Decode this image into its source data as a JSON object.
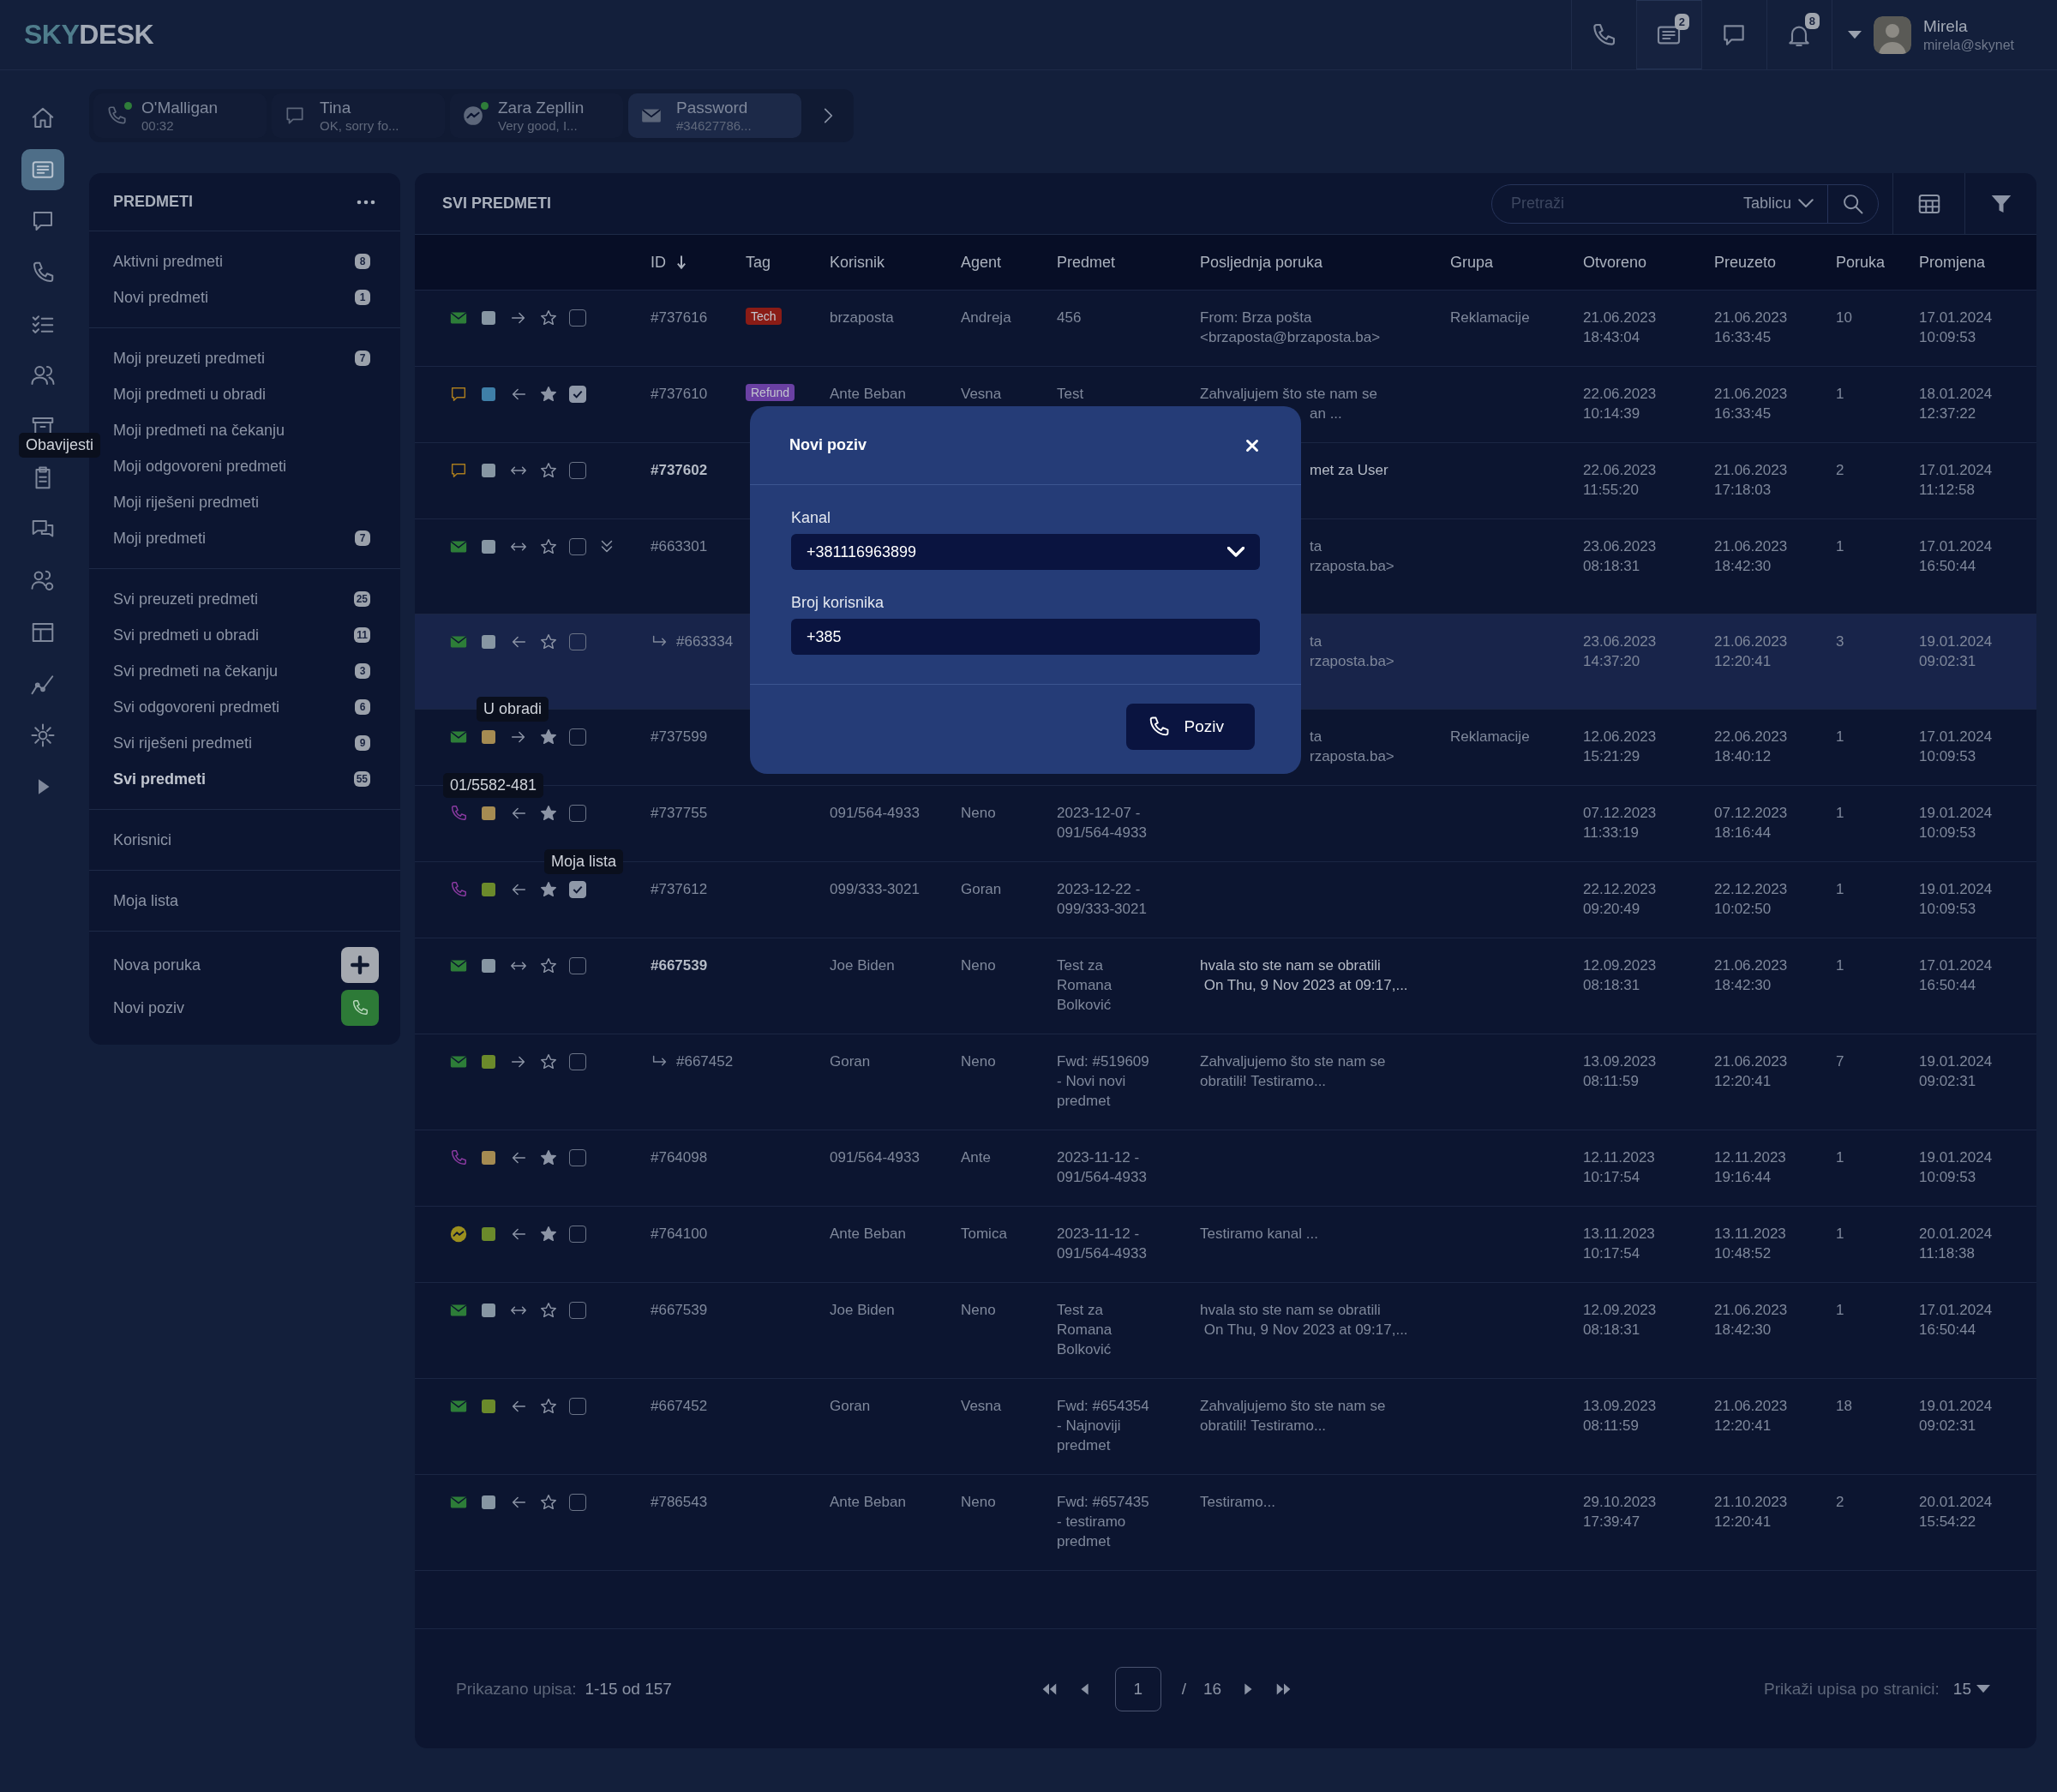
{
  "logo": {
    "first": "SKY",
    "second": "DESK"
  },
  "top_icons": [
    {
      "kind": "phone",
      "selected": false
    },
    {
      "kind": "tickets",
      "badge": "2",
      "selected": true
    },
    {
      "kind": "chat",
      "selected": false
    },
    {
      "kind": "bell",
      "badge": "8",
      "selected": false
    }
  ],
  "user": {
    "name": "Mirela",
    "email": "mirela@skynet"
  },
  "rail": [
    {
      "kind": "home",
      "selected": false
    },
    {
      "kind": "tickets",
      "selected": true
    },
    {
      "kind": "chat",
      "selected": false
    },
    {
      "kind": "phone",
      "selected": false
    },
    {
      "kind": "checklist",
      "selected": false
    },
    {
      "kind": "users",
      "selected": false
    },
    {
      "kind": "archive",
      "selected": false
    },
    {
      "kind": "clipboard",
      "selected": false
    },
    {
      "kind": "chats",
      "selected": false
    },
    {
      "kind": "usersgear",
      "selected": false
    },
    {
      "kind": "layout",
      "selected": false
    },
    {
      "kind": "chart",
      "selected": false
    },
    {
      "kind": "gear",
      "selected": false
    },
    {
      "kind": "play",
      "selected": false
    }
  ],
  "conversation_tabs": [
    {
      "kind": "phone",
      "name": "O'Malligan",
      "preview": "00:32",
      "online": true,
      "selected": false
    },
    {
      "kind": "chat",
      "name": "Tina",
      "preview": "OK, sorry fo...",
      "online": false,
      "selected": false
    },
    {
      "kind": "messenger",
      "name": "Zara Zepllin",
      "preview": "Very good, I...",
      "online": true,
      "selected": false
    },
    {
      "kind": "email",
      "name": "Password",
      "preview": "#34627786...",
      "online": false,
      "selected": true
    }
  ],
  "sidebar": {
    "title": "PREDMETI",
    "groups": [
      [
        {
          "kind": "link",
          "label": "Aktivni predmeti",
          "count": "8",
          "selected": false
        },
        {
          "kind": "link",
          "label": "Novi predmeti",
          "count": "1",
          "selected": false
        }
      ],
      [
        {
          "kind": "link",
          "label": "Moji preuzeti predmeti",
          "count": "7",
          "selected": false
        },
        {
          "kind": "link",
          "label": "Moji predmeti u obradi",
          "selected": false
        },
        {
          "kind": "link",
          "label": "Moji predmeti na čekanju",
          "selected": false
        },
        {
          "kind": "link",
          "label": "Moji odgovoreni predmeti",
          "selected": false
        },
        {
          "kind": "link",
          "label": "Moji riješeni predmeti",
          "selected": false
        },
        {
          "kind": "link",
          "label": "Moji predmeti",
          "count": "7",
          "selected": false
        }
      ],
      [
        {
          "kind": "link",
          "label": "Svi preuzeti predmeti",
          "count": "25",
          "selected": false
        },
        {
          "kind": "link",
          "label": "Svi predmeti u obradi",
          "count": "11",
          "selected": false
        },
        {
          "kind": "link",
          "label": "Svi predmeti na čekanju",
          "count": "3",
          "selected": false
        },
        {
          "kind": "link",
          "label": "Svi odgovoreni predmeti",
          "count": "6",
          "selected": false
        },
        {
          "kind": "link",
          "label": "Svi riješeni predmeti",
          "count": "9",
          "selected": false
        },
        {
          "kind": "link",
          "label": "Svi predmeti",
          "count": "55",
          "selected": true
        }
      ],
      [
        {
          "kind": "link",
          "label": "Korisnici",
          "selected": false
        }
      ],
      [
        {
          "kind": "link",
          "label": "Moja lista",
          "selected": false
        }
      ],
      [
        {
          "kind": "plus",
          "label": "Nova poruka",
          "selected": false
        },
        {
          "kind": "call",
          "label": "Novi poziv",
          "selected": false
        }
      ]
    ]
  },
  "panel": {
    "title": "SVI PREDMETI",
    "search": {
      "placeholder": "Pretraži",
      "scope": "Tablicu"
    }
  },
  "columns": [
    {
      "label": "ID",
      "sorted": true
    },
    {
      "label": "Tag",
      "sorted": false
    },
    {
      "label": "Korisnik",
      "sorted": false
    },
    {
      "label": "Agent",
      "sorted": false
    },
    {
      "label": "Predmet",
      "sorted": false
    },
    {
      "label": "Posljednja poruka",
      "sorted": false
    },
    {
      "label": "Grupa",
      "sorted": false
    },
    {
      "label": "Otvoreno",
      "sorted": false
    },
    {
      "label": "Preuzeto",
      "sorted": false
    },
    {
      "label": "Poruka",
      "sorted": false
    },
    {
      "label": "Promjena",
      "sorted": false
    }
  ],
  "rows": [
    {
      "kind": "email",
      "color": "#8796a3",
      "incoming": false,
      "outgoing": true,
      "starred": false,
      "checked": false,
      "expand": false,
      "forwarded": false,
      "unread": false,
      "hovered": false,
      "id": "#737616",
      "tag": {
        "label": "Tech",
        "color": "#8a1c16"
      },
      "user": "brzaposta",
      "agent": "Andreja",
      "subject": "456",
      "message": "From: Brza pošta\n<brzaposta@brzaposta.ba>",
      "group": "Reklamacije",
      "opened": "21.06.2023\n18:43:04",
      "taken": "21.06.2023\n16:33:45",
      "count": "10",
      "changed": "17.01.2024\n10:09:53"
    },
    {
      "kind": "chat",
      "color": "#3f7fa8",
      "incoming": true,
      "outgoing": false,
      "starred": true,
      "checked": true,
      "expand": false,
      "forwarded": false,
      "unread": false,
      "hovered": false,
      "id": "#737610",
      "tag": {
        "label": "Refund",
        "color": "#6a40a3"
      },
      "user": "Ante Beban",
      "agent": "Vesna",
      "subject": "Test",
      "message": "Zahvaljujem što ste nam se",
      "message_cut": "an ...",
      "opened": "22.06.2023\n10:14:39",
      "taken": "21.06.2023\n16:33:45",
      "count": "1",
      "changed": "18.01.2024\n12:37:22"
    },
    {
      "kind": "chat",
      "color": "#8796a3",
      "incoming": true,
      "outgoing": true,
      "starred": false,
      "checked": false,
      "expand": false,
      "forwarded": false,
      "unread": true,
      "hovered": false,
      "id": "#737602",
      "message_cut": "met za User",
      "opened": "22.06.2023\n11:55:20",
      "taken": "21.06.2023\n17:18:03",
      "count": "2",
      "changed": "17.01.2024\n11:12:58"
    },
    {
      "kind": "email",
      "color": "#8796a3",
      "incoming": true,
      "outgoing": true,
      "starred": false,
      "checked": false,
      "expand": true,
      "forwarded": false,
      "unread": false,
      "hovered": false,
      "id": "#663301",
      "message_cut": "ta\nrzaposta.ba>",
      "opened": "23.06.2023\n08:18:31",
      "taken": "21.06.2023\n18:42:30",
      "count": "1",
      "changed": "17.01.2024\n16:50:44"
    },
    {
      "kind": "email",
      "color": "#8796a3",
      "incoming": true,
      "outgoing": false,
      "starred": false,
      "checked": false,
      "expand": false,
      "forwarded": true,
      "unread": false,
      "hovered": true,
      "id": "#663334",
      "message_cut": "ta\nrzaposta.ba>",
      "opened": "23.06.2023\n14:37:20",
      "taken": "21.06.2023\n12:20:41",
      "count": "3",
      "changed": "19.01.2024\n09:02:31"
    },
    {
      "kind": "email",
      "color": "#a58b52",
      "incoming": false,
      "outgoing": true,
      "starred": true,
      "checked": false,
      "expand": false,
      "forwarded": false,
      "unread": false,
      "hovered": false,
      "id": "#737599",
      "group": "Reklamacije",
      "message_cut": "ta\nrzaposta.ba>",
      "opened": "12.06.2023\n15:21:29",
      "taken": "22.06.2023\n18:40:12",
      "count": "1",
      "changed": "17.01.2024\n10:09:53"
    },
    {
      "kind": "phone",
      "color": "#a58b52",
      "incoming": true,
      "outgoing": false,
      "starred": true,
      "checked": false,
      "expand": false,
      "forwarded": false,
      "unread": false,
      "hovered": false,
      "id": "#737755",
      "user": "091/564-4933",
      "agent": "Neno",
      "subject": "2023-12-07 -\n091/564-4933",
      "opened": "07.12.2023\n11:33:19",
      "taken": "07.12.2023\n18:16:44",
      "count": "1",
      "changed": "19.01.2024\n10:09:53"
    },
    {
      "kind": "phone",
      "color": "#6b8a2b",
      "incoming": true,
      "outgoing": false,
      "starred": true,
      "checked": true,
      "expand": false,
      "forwarded": false,
      "unread": false,
      "hovered": false,
      "id": "#737612",
      "user": "099/333-3021",
      "agent": "Goran",
      "subject": "2023-12-22 -\n099/333-3021",
      "opened": "22.12.2023\n09:20:49",
      "taken": "22.12.2023\n10:02:50",
      "count": "1",
      "changed": "19.01.2024\n10:09:53"
    },
    {
      "kind": "email",
      "color": "#8796a3",
      "incoming": true,
      "outgoing": true,
      "starred": false,
      "checked": false,
      "expand": false,
      "forwarded": false,
      "unread": true,
      "hovered": false,
      "id": "#667539",
      "user": "Joe Biden",
      "agent": "Neno",
      "subject": "Test za\nRomana\nBolković",
      "message": "hvala sto ste nam se obratili\n On Thu, 9 Nov 2023 at 09:17,...",
      "opened": "12.09.2023\n08:18:31",
      "taken": "21.06.2023\n18:42:30",
      "count": "1",
      "changed": "17.01.2024\n16:50:44"
    },
    {
      "kind": "email",
      "color": "#6b8a2b",
      "incoming": false,
      "outgoing": true,
      "starred": false,
      "checked": false,
      "expand": false,
      "forwarded": true,
      "unread": false,
      "hovered": false,
      "id": "#667452",
      "user": "Goran",
      "agent": "Neno",
      "subject": "Fwd: #519609\n- Novi novi\npredmet",
      "message": "Zahvaljujemo što ste nam se\nobratili! Testiramo...",
      "opened": "13.09.2023\n08:11:59",
      "taken": "21.06.2023\n12:20:41",
      "count": "7",
      "changed": "19.01.2024\n09:02:31"
    },
    {
      "kind": "phone",
      "color": "#a58b52",
      "incoming": true,
      "outgoing": false,
      "starred": true,
      "checked": false,
      "expand": false,
      "forwarded": false,
      "unread": false,
      "hovered": false,
      "id": "#764098",
      "user": "091/564-4933",
      "agent": "Ante",
      "subject": "2023-11-12 -\n091/564-4933",
      "opened": "12.11.2023\n10:17:54",
      "taken": "12.11.2023\n19:16:44",
      "count": "1",
      "changed": "19.01.2024\n10:09:53"
    },
    {
      "kind": "messenger",
      "color": "#6b8a2b",
      "incoming": true,
      "outgoing": false,
      "starred": true,
      "checked": false,
      "expand": false,
      "forwarded": false,
      "unread": false,
      "hovered": false,
      "id": "#764100",
      "user": "Ante Beban",
      "agent": "Tomica",
      "subject": "2023-11-12 -\n091/564-4933",
      "message": "Testiramo kanal ...",
      "opened": "13.11.2023\n10:17:54",
      "taken": "13.11.2023\n10:48:52",
      "count": "1",
      "changed": "20.01.2024\n11:18:38"
    },
    {
      "kind": "email",
      "color": "#8796a3",
      "incoming": true,
      "outgoing": true,
      "starred": false,
      "checked": false,
      "expand": false,
      "forwarded": false,
      "unread": false,
      "hovered": false,
      "id": "#667539",
      "user": "Joe Biden",
      "agent": "Neno",
      "subject": "Test za\nRomana\nBolković",
      "message": "hvala sto ste nam se obratili\n On Thu, 9 Nov 2023 at 09:17,...",
      "opened": "12.09.2023\n08:18:31",
      "taken": "21.06.2023\n18:42:30",
      "count": "1",
      "changed": "17.01.2024\n16:50:44"
    },
    {
      "kind": "email",
      "color": "#6b8a2b",
      "incoming": true,
      "outgoing": false,
      "starred": false,
      "checked": false,
      "expand": false,
      "forwarded": false,
      "unread": false,
      "hovered": false,
      "id": "#667452",
      "user": "Goran",
      "agent": "Vesna",
      "subject": "Fwd: #654354\n- Najnoviji\npredmet",
      "message": "Zahvaljujemo što ste nam se\nobratili! Testiramo...",
      "opened": "13.09.2023\n08:11:59",
      "taken": "21.06.2023\n12:20:41",
      "count": "18",
      "changed": "19.01.2024\n09:02:31"
    },
    {
      "kind": "email",
      "color": "#8796a3",
      "incoming": true,
      "outgoing": false,
      "starred": false,
      "checked": false,
      "expand": false,
      "forwarded": false,
      "unread": false,
      "hovered": false,
      "id": "#786543",
      "user": "Ante Beban",
      "agent": "Neno",
      "subject": "Fwd: #657435\n- testiramo\npredmet",
      "message": "Testiramo...",
      "opened": "29.10.2023\n17:39:47",
      "taken": "21.10.2023\n12:20:41",
      "count": "2",
      "changed": "20.01.2024\n15:54:22"
    }
  ],
  "footer": {
    "shown_label": "Prikazano upisa:",
    "shown_value": "1-15 od 157",
    "page": "1",
    "separator": "/",
    "pages": "16",
    "per_page_label": "Prikaži upisa po stranici:",
    "per_page": "15"
  },
  "tooltips": [
    {
      "kind": "rail",
      "text": "Obavijesti"
    },
    {
      "kind": "status",
      "text": "U obradi"
    },
    {
      "kind": "phone",
      "text": "01/5582-481"
    },
    {
      "kind": "star",
      "text": "Moja lista"
    }
  ],
  "dialog": {
    "title": "Novi poziv",
    "channel_label": "Kanal",
    "channel_value": "+381116963899",
    "number_label": "Broj korisnika",
    "number_value": "+385",
    "call_button": "Poziv"
  }
}
